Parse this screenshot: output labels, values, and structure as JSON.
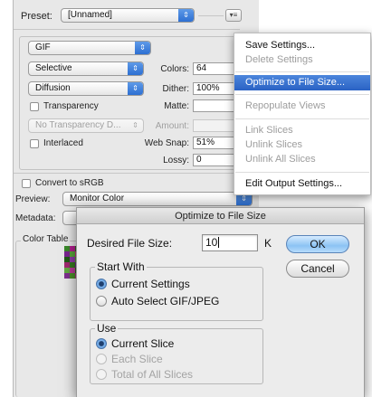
{
  "panel": {
    "preset_label": "Preset:",
    "preset_value": "[Unnamed]",
    "format_value": "GIF",
    "reduction_value": "Selective",
    "colors_label": "Colors:",
    "colors_value": "64",
    "dither_algo_value": "Diffusion",
    "dither_label": "Dither:",
    "dither_value": "100%",
    "transparency_label": "Transparency",
    "matte_label": "Matte:",
    "trans_dither_value": "No Transparency D...",
    "amount_label": "Amount:",
    "interlaced_label": "Interlaced",
    "websnap_label": "Web Snap:",
    "websnap_value": "51%",
    "lossy_label": "Lossy:",
    "lossy_value": "0",
    "convert_label": "Convert to sRGB",
    "preview_label": "Preview:",
    "preview_value": "Monitor Color",
    "metadata_label": "Metadata:",
    "color_table_label": "Color Table",
    "swatch_colors": [
      "#3a8a2a",
      "#b01e8c",
      "#2e6b1c",
      "#7a2590",
      "#5aa23a",
      "#c0327a",
      "#1f5c14",
      "#8e3aa6",
      "#4e9a2e",
      "#a12870",
      "#36781f",
      "#6c2a86",
      "#62aa42",
      "#b83a96",
      "#2a6418",
      "#7e2f8e",
      "#4a8e2a",
      "#a8307e"
    ]
  },
  "menu": {
    "items": [
      {
        "label": "Save Settings...",
        "enabled": true
      },
      {
        "label": "Delete Settings",
        "enabled": false
      },
      {
        "label": "Optimize to File Size...",
        "enabled": true,
        "highlighted": true
      },
      {
        "label": "Repopulate Views",
        "enabled": false
      },
      {
        "label": "Link Slices",
        "enabled": false
      },
      {
        "label": "Unlink Slices",
        "enabled": false
      },
      {
        "label": "Unlink All Slices",
        "enabled": false
      },
      {
        "label": "Edit Output Settings...",
        "enabled": true
      }
    ]
  },
  "dialog": {
    "title": "Optimize to File Size",
    "desired_label": "Desired File Size:",
    "desired_value": "10",
    "unit": "K",
    "ok_label": "OK",
    "cancel_label": "Cancel",
    "start_with": {
      "title": "Start With",
      "options": [
        {
          "label": "Current Settings",
          "selected": true,
          "enabled": true
        },
        {
          "label": "Auto Select GIF/JPEG",
          "selected": false,
          "enabled": true
        }
      ]
    },
    "use": {
      "title": "Use",
      "options": [
        {
          "label": "Current Slice",
          "selected": true,
          "enabled": true
        },
        {
          "label": "Each Slice",
          "selected": false,
          "enabled": false
        },
        {
          "label": "Total of All Slices",
          "selected": false,
          "enabled": false
        }
      ]
    }
  }
}
